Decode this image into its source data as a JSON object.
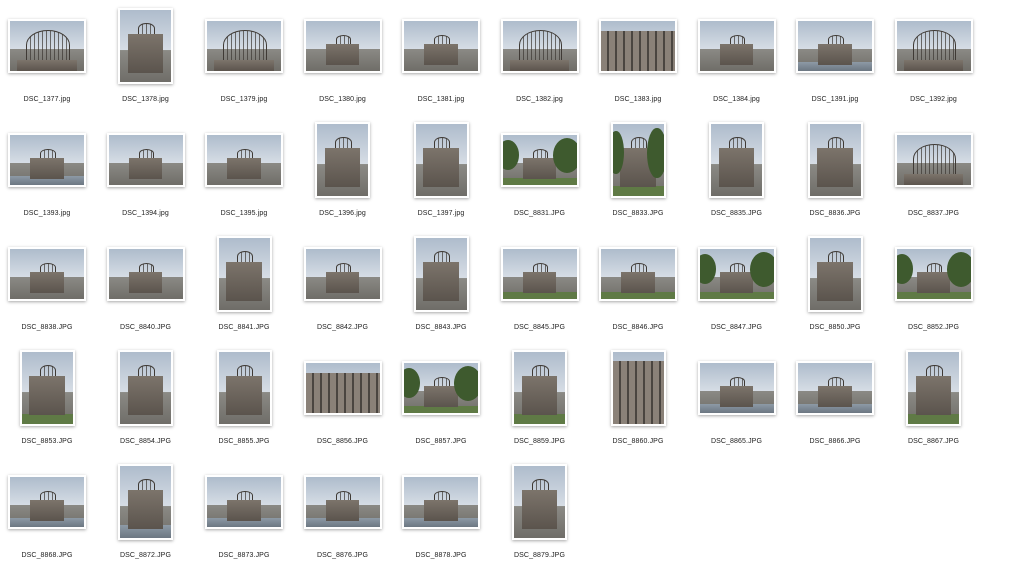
{
  "window": {
    "title": ""
  },
  "files": [
    {
      "name": "DSC_1377.jpg",
      "orientation": "landscape",
      "subject": "dome-closeup"
    },
    {
      "name": "DSC_1378.jpg",
      "orientation": "portrait",
      "subject": "building"
    },
    {
      "name": "DSC_1379.jpg",
      "orientation": "landscape",
      "subject": "dome-closeup"
    },
    {
      "name": "DSC_1380.jpg",
      "orientation": "landscape",
      "subject": "building"
    },
    {
      "name": "DSC_1381.jpg",
      "orientation": "landscape",
      "subject": "building"
    },
    {
      "name": "DSC_1382.jpg",
      "orientation": "landscape",
      "subject": "dome-closeup"
    },
    {
      "name": "DSC_1383.jpg",
      "orientation": "landscape",
      "subject": "wall"
    },
    {
      "name": "DSC_1384.jpg",
      "orientation": "landscape",
      "subject": "building"
    },
    {
      "name": "DSC_1391.jpg",
      "orientation": "landscape",
      "subject": "river"
    },
    {
      "name": "DSC_1392.jpg",
      "orientation": "landscape",
      "subject": "dome-closeup"
    },
    {
      "name": "DSC_1393.jpg",
      "orientation": "landscape",
      "subject": "river"
    },
    {
      "name": "DSC_1394.jpg",
      "orientation": "landscape",
      "subject": "building"
    },
    {
      "name": "DSC_1395.jpg",
      "orientation": "landscape",
      "subject": "building"
    },
    {
      "name": "DSC_1396.jpg",
      "orientation": "portrait",
      "subject": "building"
    },
    {
      "name": "DSC_1397.jpg",
      "orientation": "portrait",
      "subject": "building"
    },
    {
      "name": "DSC_8831.JPG",
      "orientation": "landscape",
      "subject": "trees"
    },
    {
      "name": "DSC_8833.JPG",
      "orientation": "portrait",
      "subject": "trees"
    },
    {
      "name": "DSC_8835.JPG",
      "orientation": "portrait",
      "subject": "building"
    },
    {
      "name": "DSC_8836.JPG",
      "orientation": "portrait",
      "subject": "building"
    },
    {
      "name": "DSC_8837.JPG",
      "orientation": "landscape",
      "subject": "dome-closeup"
    },
    {
      "name": "DSC_8838.JPG",
      "orientation": "landscape",
      "subject": "building"
    },
    {
      "name": "DSC_8840.JPG",
      "orientation": "landscape",
      "subject": "building"
    },
    {
      "name": "DSC_8841.JPG",
      "orientation": "portrait",
      "subject": "building"
    },
    {
      "name": "DSC_8842.JPG",
      "orientation": "landscape",
      "subject": "building"
    },
    {
      "name": "DSC_8843.JPG",
      "orientation": "portrait",
      "subject": "building"
    },
    {
      "name": "DSC_8845.JPG",
      "orientation": "landscape",
      "subject": "grass"
    },
    {
      "name": "DSC_8846.JPG",
      "orientation": "landscape",
      "subject": "grass"
    },
    {
      "name": "DSC_8847.JPG",
      "orientation": "landscape",
      "subject": "trees"
    },
    {
      "name": "DSC_8850.JPG",
      "orientation": "portrait",
      "subject": "building"
    },
    {
      "name": "DSC_8852.JPG",
      "orientation": "landscape",
      "subject": "trees"
    },
    {
      "name": "DSC_8853.JPG",
      "orientation": "portrait",
      "subject": "grass"
    },
    {
      "name": "DSC_8854.JPG",
      "orientation": "portrait",
      "subject": "building"
    },
    {
      "name": "DSC_8855.JPG",
      "orientation": "portrait",
      "subject": "building"
    },
    {
      "name": "DSC_8856.JPG",
      "orientation": "landscape",
      "subject": "wall"
    },
    {
      "name": "DSC_8857.JPG",
      "orientation": "landscape",
      "subject": "trees"
    },
    {
      "name": "DSC_8859.JPG",
      "orientation": "portrait",
      "subject": "grass"
    },
    {
      "name": "DSC_8860.JPG",
      "orientation": "portrait",
      "subject": "wall"
    },
    {
      "name": "DSC_8865.JPG",
      "orientation": "landscape",
      "subject": "river"
    },
    {
      "name": "DSC_8866.JPG",
      "orientation": "landscape",
      "subject": "river"
    },
    {
      "name": "DSC_8867.JPG",
      "orientation": "portrait",
      "subject": "grass"
    },
    {
      "name": "DSC_8868.JPG",
      "orientation": "landscape",
      "subject": "river"
    },
    {
      "name": "DSC_8872.JPG",
      "orientation": "portrait",
      "subject": "river"
    },
    {
      "name": "DSC_8873.JPG",
      "orientation": "landscape",
      "subject": "river"
    },
    {
      "name": "DSC_8876.JPG",
      "orientation": "landscape",
      "subject": "river"
    },
    {
      "name": "DSC_8878.JPG",
      "orientation": "landscape",
      "subject": "river"
    },
    {
      "name": "DSC_8879.JPG",
      "orientation": "portrait",
      "subject": "building"
    }
  ]
}
